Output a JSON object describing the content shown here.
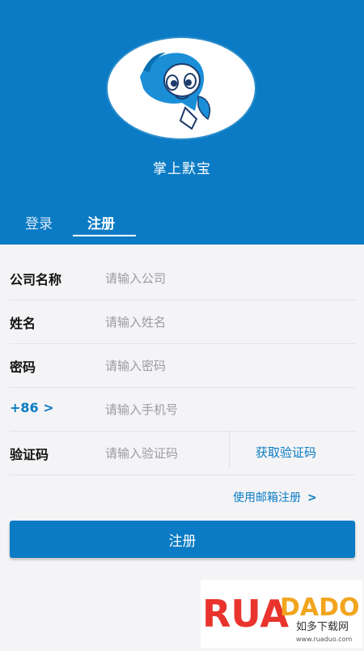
{
  "app": {
    "name": "掌上默宝"
  },
  "tabs": {
    "login": "登录",
    "register": "注册"
  },
  "form": {
    "company": {
      "label": "公司名称",
      "placeholder": "请输入公司"
    },
    "name": {
      "label": "姓名",
      "placeholder": "请输入姓名"
    },
    "password": {
      "label": "密码",
      "placeholder": "请输入密码"
    },
    "phone": {
      "code": "+86 >",
      "placeholder": "请输入手机号"
    },
    "verify": {
      "label": "验证码",
      "placeholder": "请输入验证码",
      "get_code": "获取验证码"
    }
  },
  "email_link": {
    "text": "使用邮箱注册",
    "chevron": ">"
  },
  "submit": {
    "label": "注册"
  },
  "watermark": {
    "brand": "RUADADO",
    "cn": "如多下载网",
    "url": "www.ruaduo.com"
  },
  "colors": {
    "primary": "#0a7bc4",
    "background": "#f4f4f6"
  },
  "icons": {
    "logo": "mascot-logo-icon"
  }
}
